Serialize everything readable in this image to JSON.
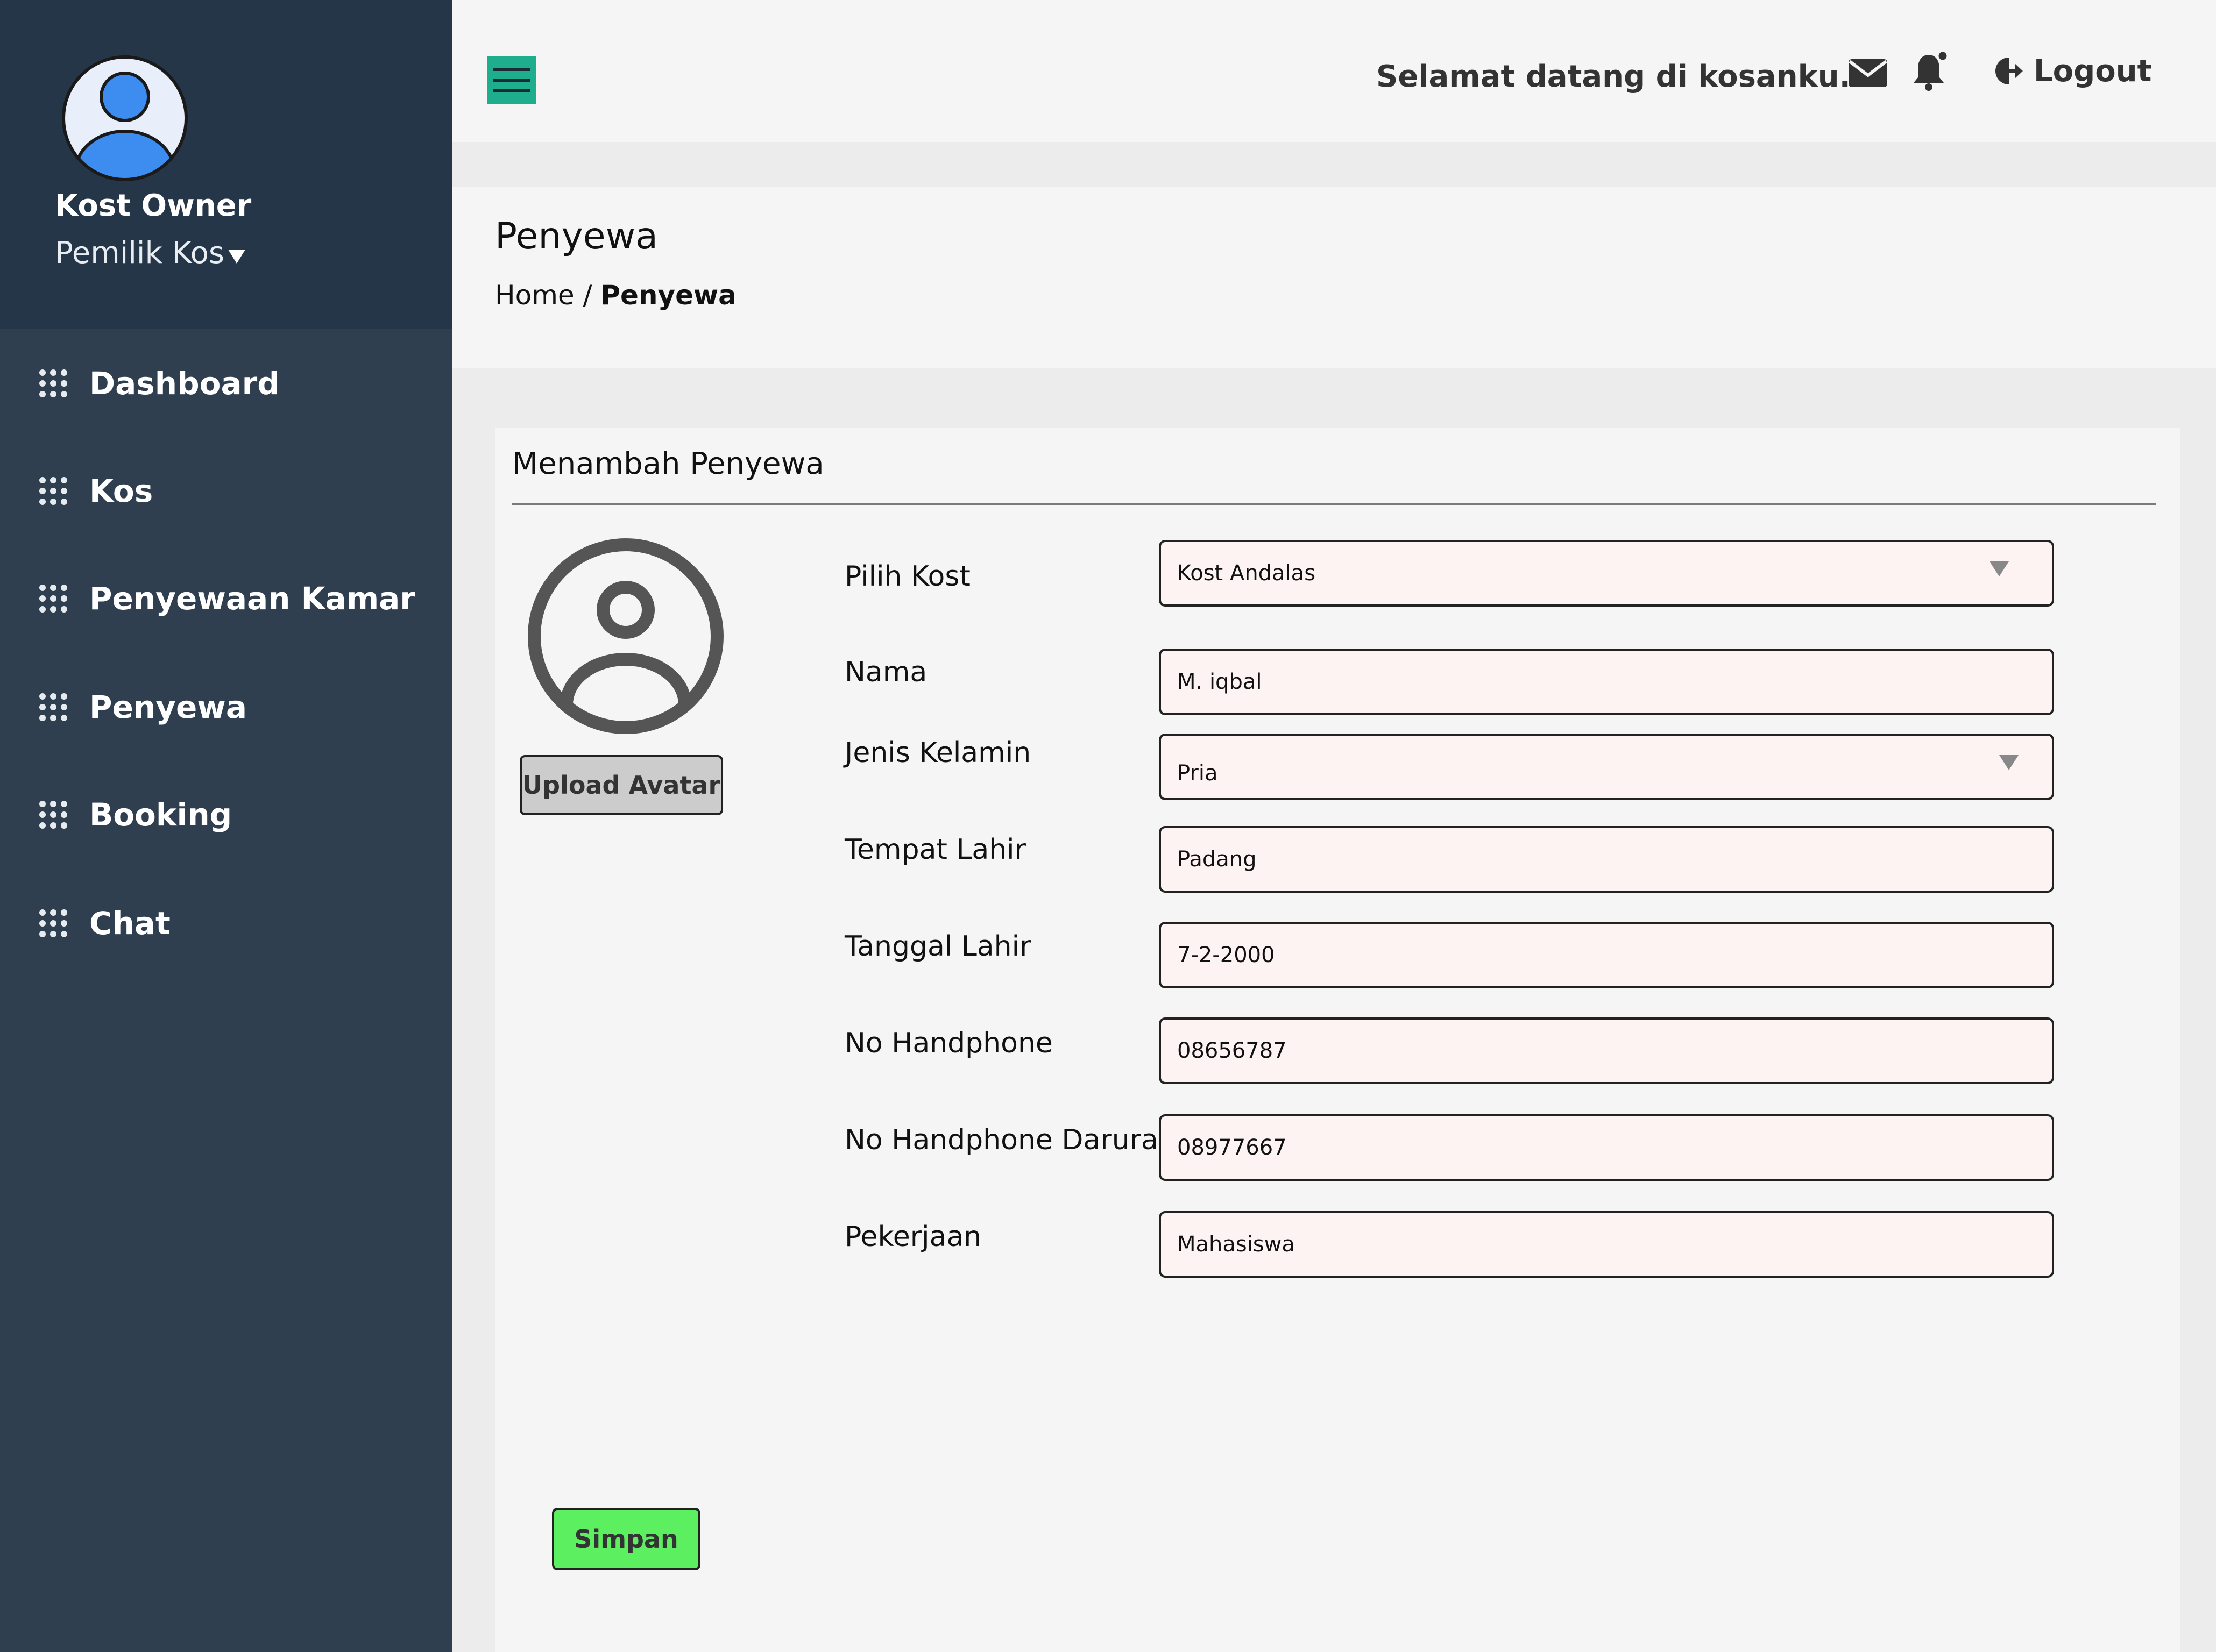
{
  "sidebar": {
    "user_name": "Kost Owner",
    "user_role": "Pemilik Kos",
    "items": [
      {
        "label": "Dashboard"
      },
      {
        "label": "Kos"
      },
      {
        "label": "Penyewaan Kamar"
      },
      {
        "label": "Penyewa"
      },
      {
        "label": "Booking"
      },
      {
        "label": "Chat"
      }
    ]
  },
  "header": {
    "welcome": "Selamat datang di kosanku....",
    "logout_label": "Logout"
  },
  "page": {
    "title": "Penyewa",
    "breadcrumb_home": "Home",
    "breadcrumb_sep": "/",
    "breadcrumb_current": "Penyewa"
  },
  "form": {
    "title": "Menambah Penyewa",
    "upload_label": "Upload Avatar",
    "save_label": "Simpan",
    "fields": [
      {
        "label": "Pilih Kost",
        "value": "Kost Andalas"
      },
      {
        "label": "Nama",
        "value": "M. iqbal"
      },
      {
        "label": "Jenis Kelamin",
        "value": "Pria"
      },
      {
        "label": "Tempat Lahir",
        "value": "Padang"
      },
      {
        "label": "Tanggal Lahir",
        "value": "7-2-2000"
      },
      {
        "label": "No Handphone",
        "value": "08656787"
      },
      {
        "label": "No Handphone Darurat",
        "value": "08977667"
      },
      {
        "label": "Pekerjaan",
        "value": "Mahasiswa"
      }
    ]
  },
  "icons": {
    "menu": "hamburger-icon",
    "mail": "mail-icon",
    "notification": "bell-icon",
    "logout": "logout-icon",
    "nav": "dots-grid-icon"
  },
  "colors": {
    "sidebar_bg": "#2f3f4f",
    "profile_bg": "#243647",
    "accent": "#1fae8d",
    "save_button": "#5cf060",
    "input_bg": "#fdf3f2",
    "avatar_blue": "#3d8cf0"
  }
}
